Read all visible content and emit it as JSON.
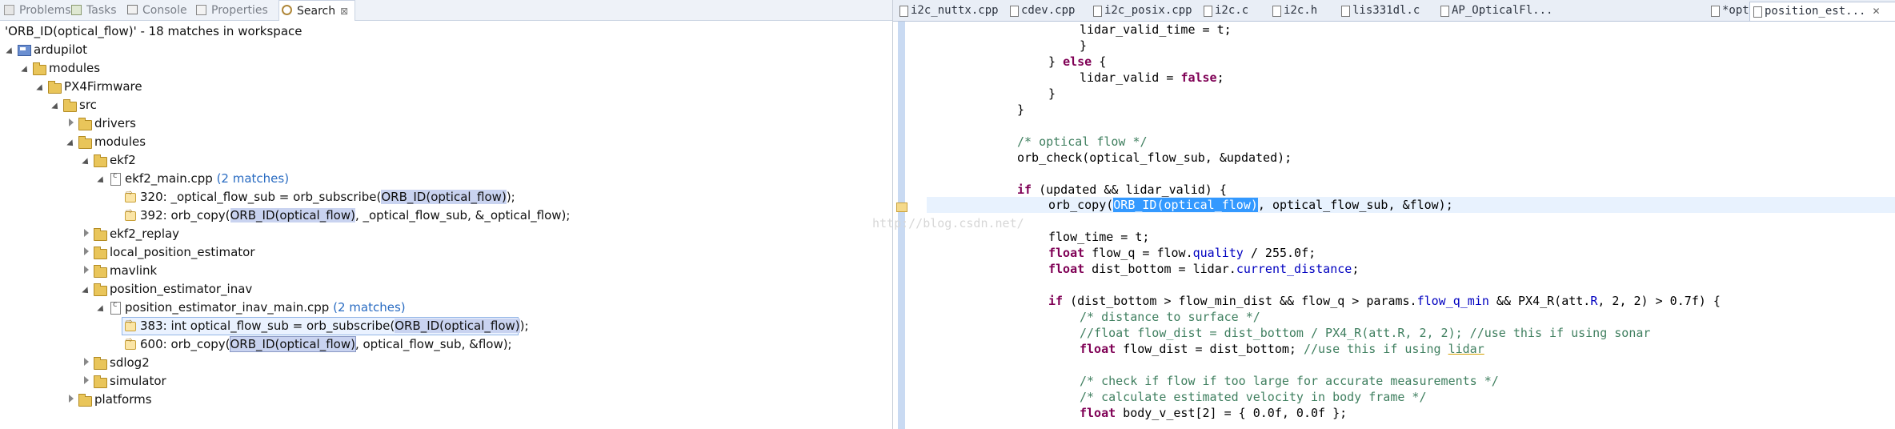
{
  "views": {
    "problems": "Problems",
    "tasks": "Tasks",
    "console": "Console",
    "properties": "Properties",
    "search": "Search",
    "close_glyph": "⊠"
  },
  "search": {
    "summary": "'ORB_ID(optical_flow)' - 18 matches in workspace"
  },
  "tree": {
    "ardupilot": "ardupilot",
    "modules": "modules",
    "px4firmware": "PX4Firmware",
    "src": "src",
    "drivers": "drivers",
    "modules2": "modules",
    "ekf2": "ekf2",
    "ekf2_main": "ekf2_main.cpp",
    "ekf2_main_count": "(2 matches)",
    "m320_pre": "320: _optical_flow_sub = orb_subscribe(",
    "m320_hl": "ORB_ID(optical_flow)",
    "m320_post": ");",
    "m392_pre": "392: orb_copy(",
    "m392_hl": "ORB_ID(optical_flow)",
    "m392_post": ", _optical_flow_sub, &_optical_flow);",
    "ekf2_replay": "ekf2_replay",
    "local_position_estimator": "local_position_estimator",
    "mavlink": "mavlink",
    "position_estimator_inav": "position_estimator_inav",
    "inav_main": "position_estimator_inav_main.cpp",
    "inav_main_count": "(2 matches)",
    "m383_pre": "383: int optical_flow_sub = orb_subscribe(",
    "m383_hl": "ORB_ID(optical_flow)",
    "m383_post": ");",
    "m600_pre": "600: orb_copy(",
    "m600_hl": "ORB_ID(optical_flow)",
    "m600_post": ", optical_flow_sub, &flow);",
    "sdlog2": "sdlog2",
    "simulator": "simulator",
    "platforms": "platforms"
  },
  "editor_tabs": {
    "t1": "i2c_nuttx.cpp",
    "t2": "cdev.cpp",
    "t3": "i2c_posix.cpp",
    "t4": "i2c.c",
    "t5": "i2c.h",
    "t6": "lis331dl.c",
    "t7": "AP_OpticalFl...",
    "t8": "*optical_flow.h",
    "t9": "position_est...",
    "close_glyph": "✕"
  },
  "code": {
    "l1": "lidar_valid_time = t;",
    "l2": "}",
    "l3a": "} ",
    "l3kw": "else",
    "l3b": " {",
    "l4a": "lidar_valid = ",
    "l4kw": "false",
    "l4b": ";",
    "l5": "}",
    "l6": "}",
    "l8": "/* optical flow */",
    "l9": "orb_check(optical_flow_sub, &updated);",
    "l11kw": "if",
    "l11": " (updated && lidar_valid) {",
    "l12a": "orb_copy(",
    "l12sel": "ORB_ID(optical_flow)",
    "l12b": ", optical_flow_sub, &flow);",
    "l14": "flow_time = t;",
    "l15kw": "float",
    "l15a": " flow_q = flow.",
    "l15f": "quality",
    "l15b": " / 255.0f;",
    "l16kw": "float",
    "l16a": " dist_bottom = lidar.",
    "l16f": "current_distance",
    "l16b": ";",
    "l18kw": "if",
    "l18a": " (dist_bottom > flow_min_dist && flow_q > params.",
    "l18f": "flow_q_min",
    "l18b": " && PX4_R(att.",
    "l18f2": "R",
    "l18c": ", 2, 2) > 0.7f) {",
    "l19": "/* distance to surface */",
    "l20": "//float flow_dist = dist_bottom / PX4_R(att.R, 2, 2); //use this if using sonar",
    "l21kw": "float",
    "l21a": " flow_dist = dist_bottom; ",
    "l21c": "//use this if using ",
    "l21u": "lidar",
    "l23": "/* check if flow if too large for accurate measurements */",
    "l24": "/* calculate estimated velocity in body frame */",
    "l25kw": "float",
    "l25a": " body_v_est[2] = { 0.0f, 0.0f };"
  },
  "watermark": "http://blog.csdn.net/"
}
